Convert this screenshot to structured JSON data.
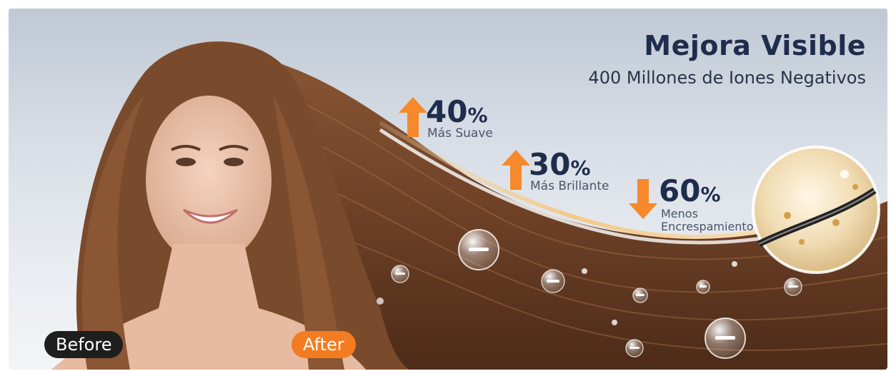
{
  "headline": {
    "title": "Mejora Visible",
    "subtitle": "400 Millones de Iones Negativos"
  },
  "stats": [
    {
      "value": "40",
      "unit": "%",
      "label": "Más Suave",
      "direction": "up"
    },
    {
      "value": "30",
      "unit": "%",
      "label": "Más Brillante",
      "direction": "up"
    },
    {
      "value": "60",
      "unit": "%",
      "label_line1": "Menos",
      "label_line2": "Encrespamiento",
      "direction": "down"
    }
  ],
  "labels": {
    "before": "Before",
    "after": "After"
  },
  "colors": {
    "title_navy": "#1f2d4d",
    "arrow_orange": "#f5892b",
    "after_pill": "#f47c20",
    "before_pill": "#1e1e1e",
    "hair_brown": "#7a4a2c"
  },
  "icons": {
    "up_arrow": "up-arrow-icon",
    "down_arrow": "down-arrow-icon",
    "droplet": "ion-droplet-icon",
    "magnifier": "magnified-hair-icon"
  }
}
